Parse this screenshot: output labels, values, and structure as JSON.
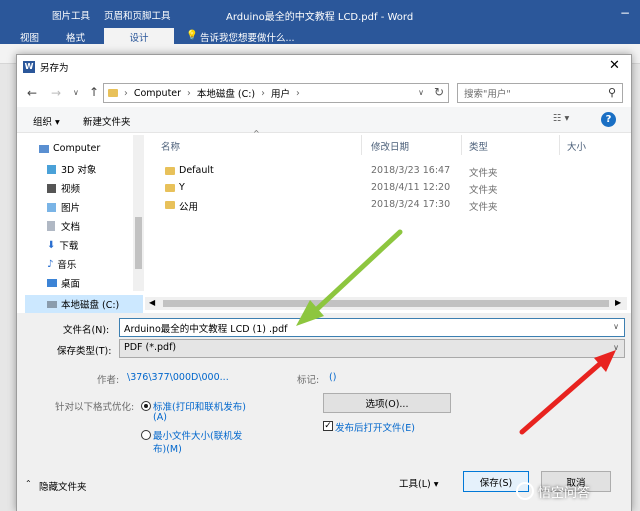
{
  "word": {
    "title": "Arduino最全的中文教程 LCD.pdf - Word",
    "context_tabs": [
      "图片工具",
      "页眉和页脚工具"
    ],
    "tabs": [
      "视图",
      "格式",
      "设计"
    ],
    "tell_me": "告诉我您想要做什么..."
  },
  "dialog": {
    "title": "另存为",
    "breadcrumb": [
      "Computer",
      "本地磁盘 (C:)",
      "用户"
    ],
    "search_placeholder": "搜索\"用户\"",
    "toolbar": {
      "organize": "组织",
      "new_folder": "新建文件夹"
    },
    "nav": [
      "Computer",
      "3D 对象",
      "视频",
      "图片",
      "文档",
      "下载",
      "音乐",
      "桌面",
      "本地磁盘 (C:)"
    ],
    "columns": {
      "name": "名称",
      "date": "修改日期",
      "type": "类型",
      "size": "大小"
    },
    "files": [
      {
        "name": "Default",
        "date": "2018/3/23 16:47",
        "type": "文件夹"
      },
      {
        "name": "Y",
        "date": "2018/4/11 12:20",
        "type": "文件夹"
      },
      {
        "name": "公用",
        "date": "2018/3/24 17:30",
        "type": "文件夹"
      }
    ],
    "filename_label": "文件名(N):",
    "filename_value": "Arduino最全的中文教程 LCD  (1) .pdf",
    "savetype_label": "保存类型(T):",
    "savetype_value": "PDF (*.pdf)",
    "author_label": "作者:",
    "author_value": "\\376\\377\\000D\\000...",
    "tags_label": "标记:",
    "tags_value": "()",
    "optimize_label": "针对以下格式优化:",
    "opt1": "标准(打印和联机发布)",
    "opt1b": "(A)",
    "opt2": "最小文件大小(联机发",
    "opt2b": "布)(M)",
    "options_btn": "选项(O)...",
    "open_after": "发布后打开文件(E)",
    "hide_folders": "隐藏文件夹",
    "tools": "工具(L)",
    "save": "保存(S)",
    "cancel": "取消"
  },
  "watermark": "悟空问答",
  "colors": {
    "word_blue": "#2b579a",
    "green_arrow": "#8dc63f",
    "red_arrow": "#e8231f",
    "link": "#0066cc"
  }
}
